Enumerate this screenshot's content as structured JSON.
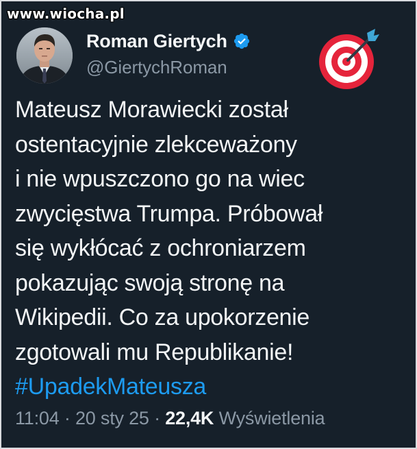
{
  "watermark": "www.wiocha.pl",
  "author": {
    "display_name": "Roman Giertych",
    "handle": "@GiertychRoman",
    "verified": true
  },
  "tweet": {
    "lines": [
      "Mateusz Morawiecki został",
      "ostentacyjnie zlekceważony",
      "i nie wpuszczono go na wiec",
      "zwycięstwa Trumpa. Próbował",
      "się wykłócać z ochroniarzem",
      "pokazując swoją stronę na",
      "Wikipedii. Co za upokorzenie",
      "zgotowali mu Republikanie!"
    ],
    "hashtag": "#UpadekMateusza",
    "time": "11:04",
    "sep1": "·",
    "date": "20 sty 25",
    "sep2": "·",
    "views_count": "22,4K",
    "views_label": "Wyświetlenia"
  },
  "colors": {
    "background": "#16202a",
    "link": "#1d9bf0",
    "muted": "#8b98a5",
    "verified": "#1d9bf0"
  },
  "icons": {
    "verified": "verified-badge-icon",
    "emoji": "direct-hit-target-emoji"
  }
}
